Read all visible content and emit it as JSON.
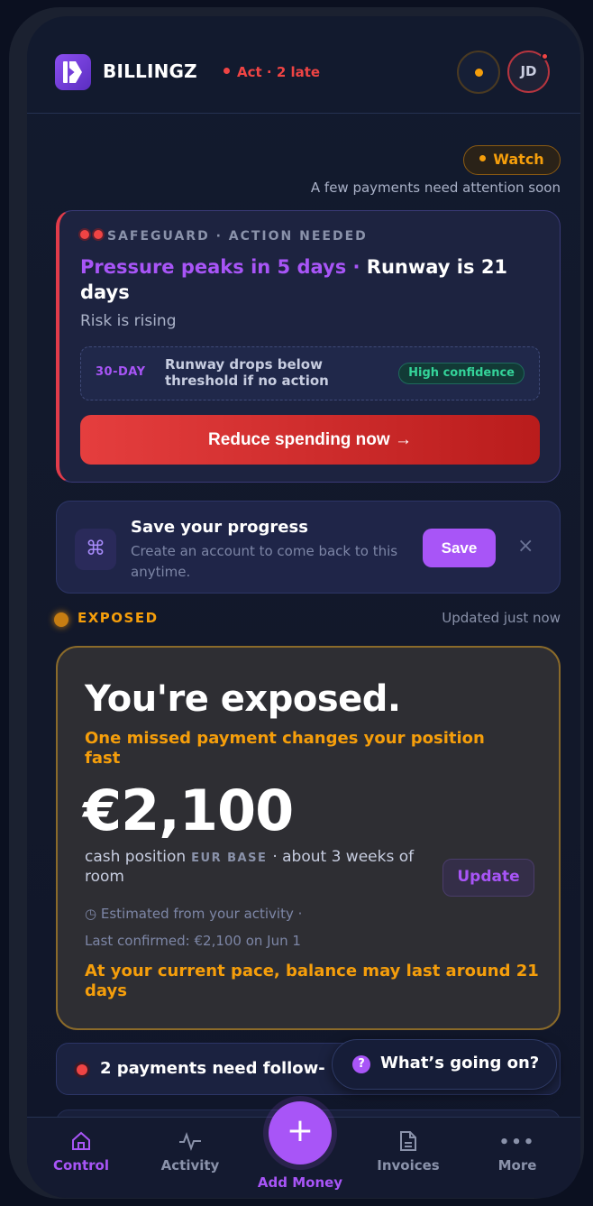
{
  "header": {
    "brand": "BILLINGZ",
    "status": "Act · 2 late",
    "avatar_initials": "JD"
  },
  "watch": {
    "label": "Watch",
    "subtitle": "A few payments need attention soon"
  },
  "safeguard": {
    "heading": "SAFEGUARD · ACTION NEEDED",
    "title_highlight": "Pressure peaks in 5 days ·",
    "title_rest": " Runway is 21 days",
    "risk": "Risk is rising",
    "box_tag": "30-DAY",
    "box_text": "Runway drops below threshold if no action",
    "confidence": "High confidence",
    "cta": "Reduce spending now →"
  },
  "save_card": {
    "icon": "⌘",
    "title": "Save your progress",
    "subtitle": "Create an account to come back to this anytime.",
    "button": "Save",
    "close": "×"
  },
  "status_row": {
    "label": "EXPOSED",
    "updated": "Updated just now"
  },
  "exposure": {
    "headline": "You're exposed.",
    "subhead": "One missed payment changes your position fast",
    "amount": "€2,100",
    "cash_label": "cash position",
    "base": "EUR BASE",
    "room": "· about 3 weeks of room",
    "update_button": "Update",
    "estimated": "◷ Estimated from your activity  ·",
    "last_confirmed": "Last confirmed: €2,100 on Jun 1",
    "pace": "At your current pace, balance may last around 21 days"
  },
  "followup": {
    "text": "2 payments need follow-"
  },
  "help_pill": {
    "icon": "?",
    "label": "What’s going on?"
  },
  "nav": {
    "control": "Control",
    "activity": "Activity",
    "add_money": "Add Money",
    "invoices": "Invoices",
    "more": "More"
  },
  "colors": {
    "accent": "#a855f7",
    "danger": "#ef4444",
    "warning": "#f59e0b",
    "success": "#34d399"
  }
}
